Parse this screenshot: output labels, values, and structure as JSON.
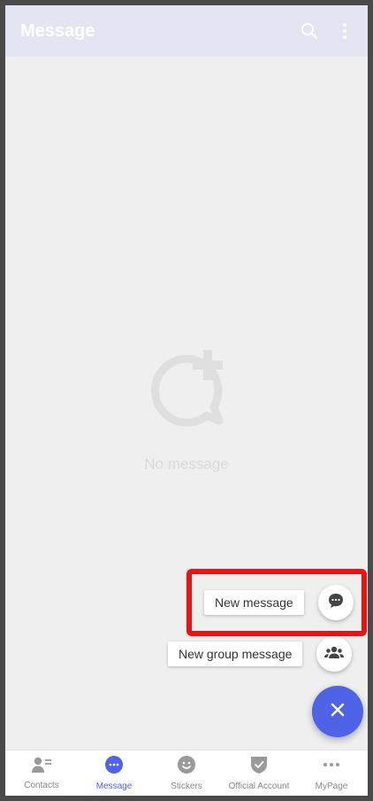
{
  "app_bar": {
    "title": "Message",
    "icons": [
      "search-icon",
      "more-vert-icon"
    ]
  },
  "empty_state": {
    "icon": "chat-add-icon",
    "text": "No message"
  },
  "fab_menu": {
    "items": [
      {
        "label": "New message",
        "icon": "chat-bubble-icon"
      },
      {
        "label": "New group message",
        "icon": "group-icon"
      }
    ],
    "main_icon": "close-icon"
  },
  "bottom_nav": {
    "items": [
      {
        "label": "Contacts",
        "icon": "contacts-icon"
      },
      {
        "label": "Message",
        "icon": "message-icon",
        "active": true
      },
      {
        "label": "Stickers",
        "icon": "sticker-icon"
      },
      {
        "label": "Official Account",
        "icon": "shield-check-icon"
      },
      {
        "label": "MyPage",
        "icon": "more-horiz-icon"
      }
    ]
  },
  "colors": {
    "accent": "#4e63e6",
    "highlight": "#ee1111",
    "app_bar_bg": "#e3e6f2",
    "inactive_icon": "#9a9a9a"
  }
}
